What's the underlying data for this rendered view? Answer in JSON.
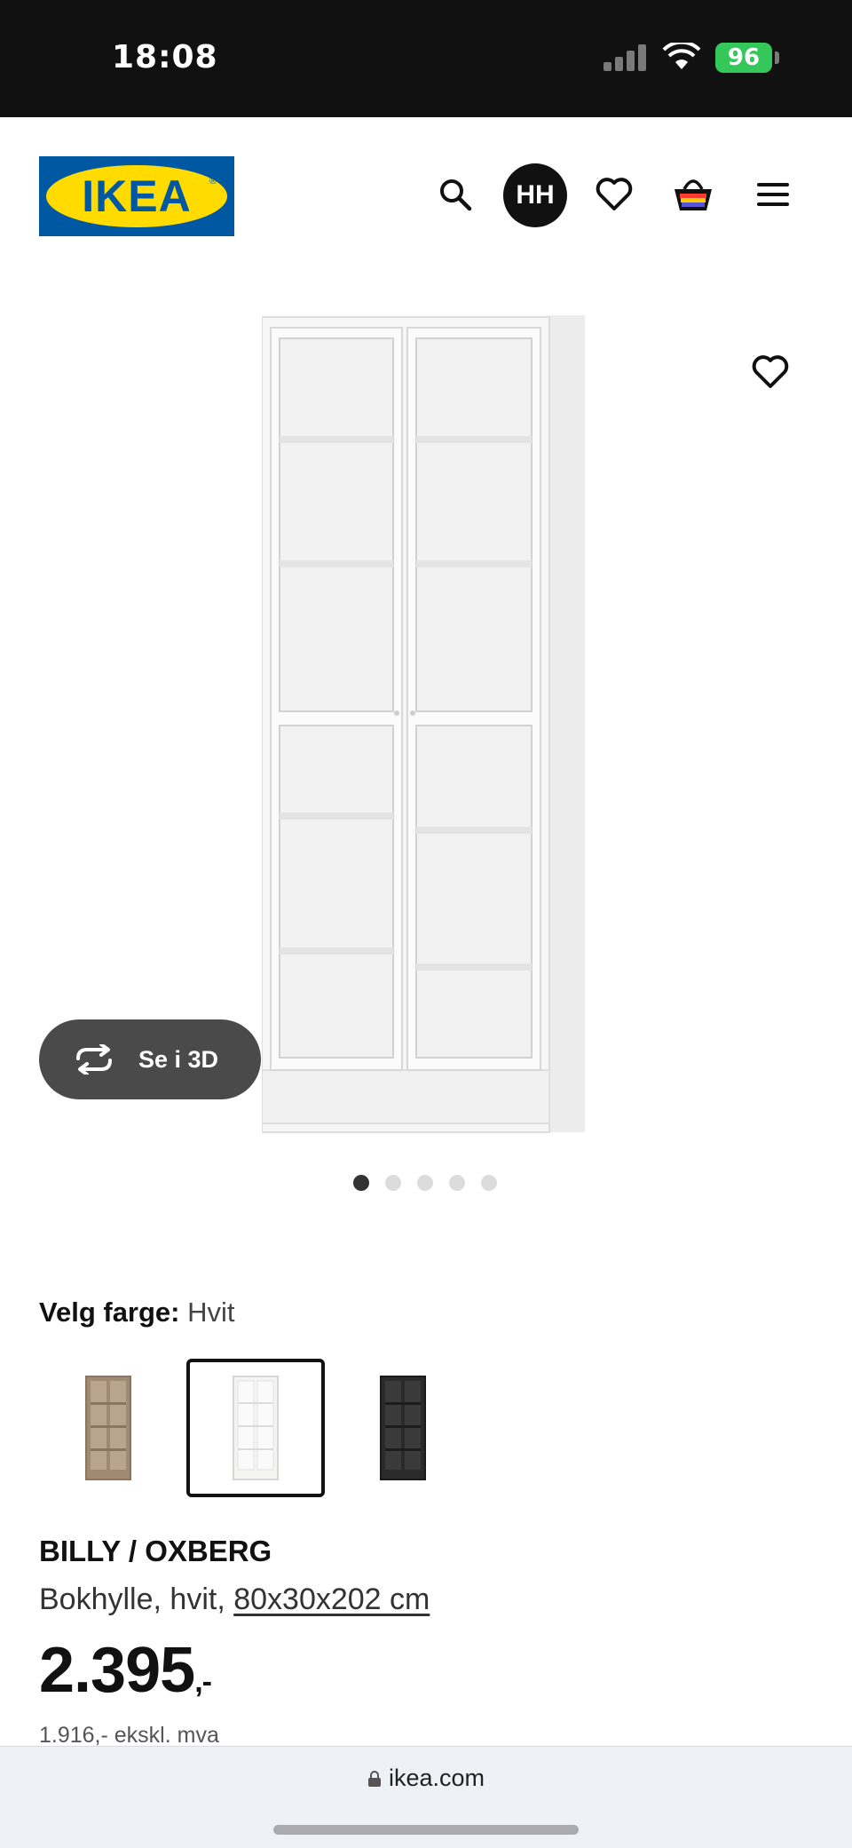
{
  "status_bar": {
    "time": "18:08",
    "battery": "96"
  },
  "header": {
    "logo_text": "IKEA",
    "avatar_initials": "HH"
  },
  "gallery": {
    "see_3d_label": "Se i 3D",
    "image_count": 5,
    "active_image": 1
  },
  "color_selector": {
    "label": "Velg farge:",
    "selected_value": "Hvit",
    "options": [
      {
        "name": "oak",
        "color": "#a08a72",
        "selected": false
      },
      {
        "name": "white",
        "color": "#f4f4f2",
        "selected": true
      },
      {
        "name": "black-brown",
        "color": "#2a2a2a",
        "selected": false
      }
    ]
  },
  "product": {
    "name": "BILLY / OXBERG",
    "description_prefix": "Bokhylle, hvit, ",
    "dimensions": "80x30x202 cm",
    "price": "2.395",
    "price_suffix": ",-",
    "price_excl_vat": "1.916,- ekskl. mva"
  },
  "browser": {
    "url": "ikea.com"
  },
  "colors": {
    "ikea_blue": "#0058a3",
    "ikea_yellow": "#ffdb00",
    "battery_green": "#34c759"
  }
}
